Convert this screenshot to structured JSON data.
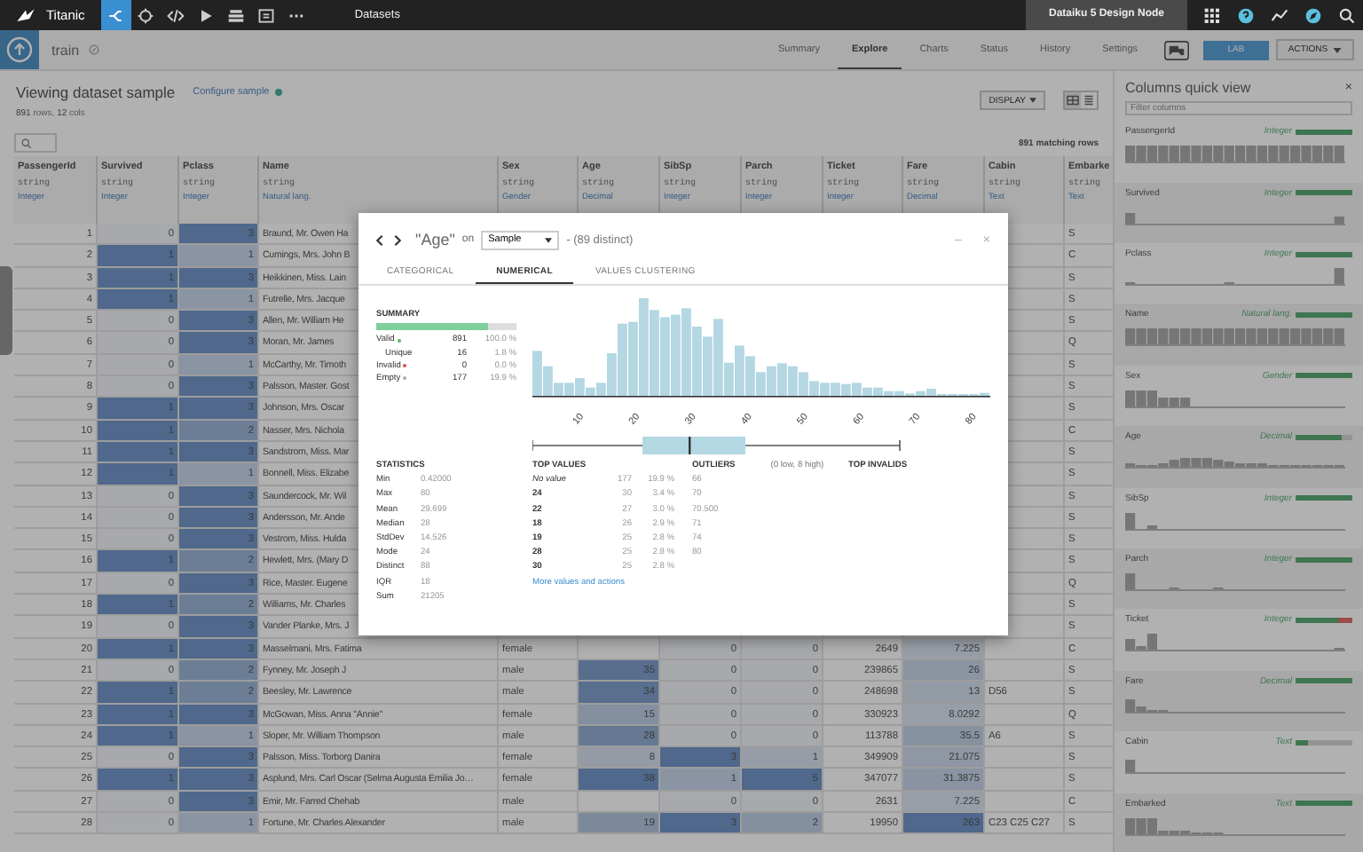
{
  "topbar": {
    "project": "Titanic",
    "nav": [
      {
        "kind": "flow",
        "selected": true
      },
      {
        "kind": "target",
        "selected": false
      },
      {
        "kind": "code",
        "selected": false
      },
      {
        "kind": "play",
        "selected": false
      },
      {
        "kind": "stack",
        "selected": false
      },
      {
        "kind": "dashboard",
        "selected": false
      },
      {
        "kind": "more",
        "selected": false
      }
    ],
    "section": "Datasets",
    "node": "Dataiku 5 Design Node",
    "tools": [
      {
        "kind": "apps"
      },
      {
        "kind": "help"
      },
      {
        "kind": "trend"
      },
      {
        "kind": "compass"
      },
      {
        "kind": "search"
      }
    ]
  },
  "dataset": {
    "name": "train",
    "tabs": [
      {
        "label": "Summary",
        "selected": false
      },
      {
        "label": "Explore",
        "selected": true
      },
      {
        "label": "Charts",
        "selected": false
      },
      {
        "label": "Status",
        "selected": false
      },
      {
        "label": "History",
        "selected": false
      },
      {
        "label": "Settings",
        "selected": false
      }
    ],
    "lab": "LAB",
    "actions": "ACTIONS"
  },
  "sample": {
    "title": "Viewing dataset sample",
    "configure": "Configure sample",
    "rows": "891",
    "rows_label": "rows,",
    "cols": "12",
    "cols_label": "cols",
    "display": "DISPLAY",
    "matching": "891 matching rows"
  },
  "table": {
    "columns": [
      {
        "name": "PassengerId",
        "storage": "string",
        "meaning": "Integer"
      },
      {
        "name": "Survived",
        "storage": "string",
        "meaning": "Integer"
      },
      {
        "name": "Pclass",
        "storage": "string",
        "meaning": "Integer"
      },
      {
        "name": "Name",
        "storage": "string",
        "meaning": "Natural lang."
      },
      {
        "name": "Sex",
        "storage": "string",
        "meaning": "Gender"
      },
      {
        "name": "Age",
        "storage": "string",
        "meaning": "Decimal"
      },
      {
        "name": "SibSp",
        "storage": "string",
        "meaning": "Integer"
      },
      {
        "name": "Parch",
        "storage": "string",
        "meaning": "Integer"
      },
      {
        "name": "Ticket",
        "storage": "string",
        "meaning": "Integer"
      },
      {
        "name": "Fare",
        "storage": "string",
        "meaning": "Decimal"
      },
      {
        "name": "Cabin",
        "storage": "string",
        "meaning": "Text"
      },
      {
        "name": "Embarke",
        "storage": "string",
        "meaning": "Text"
      }
    ],
    "rows": [
      [
        "1",
        "0",
        "3",
        "Braund, Mr. Owen Ha",
        null,
        null,
        null,
        null,
        null,
        null,
        null,
        "S"
      ],
      [
        "2",
        "1",
        "1",
        "Cumings, Mrs. John B",
        null,
        null,
        null,
        null,
        null,
        null,
        null,
        "C"
      ],
      [
        "3",
        "1",
        "3",
        "Heikkinen, Miss. Lain",
        null,
        null,
        null,
        null,
        null,
        null,
        null,
        "S"
      ],
      [
        "4",
        "1",
        "1",
        "Futrelle, Mrs. Jacque",
        null,
        null,
        null,
        null,
        null,
        null,
        null,
        "S"
      ],
      [
        "5",
        "0",
        "3",
        "Allen, Mr. William He",
        null,
        null,
        null,
        null,
        null,
        null,
        null,
        "S"
      ],
      [
        "6",
        "0",
        "3",
        "Moran, Mr. James",
        null,
        null,
        null,
        null,
        null,
        null,
        null,
        "Q"
      ],
      [
        "7",
        "0",
        "1",
        "McCarthy, Mr. Timoth",
        null,
        null,
        null,
        null,
        null,
        null,
        null,
        "S"
      ],
      [
        "8",
        "0",
        "3",
        "Palsson, Master. Gost",
        null,
        null,
        null,
        null,
        null,
        null,
        null,
        "S"
      ],
      [
        "9",
        "1",
        "3",
        "Johnson, Mrs. Oscar",
        null,
        null,
        null,
        null,
        null,
        null,
        null,
        "S"
      ],
      [
        "10",
        "1",
        "2",
        "Nasser, Mrs. Nichola",
        null,
        null,
        null,
        null,
        null,
        null,
        null,
        "C"
      ],
      [
        "11",
        "1",
        "3",
        "Sandstrom, Miss. Mar",
        null,
        null,
        null,
        null,
        null,
        null,
        null,
        "S"
      ],
      [
        "12",
        "1",
        "1",
        "Bonnell, Miss. Elizabe",
        null,
        null,
        null,
        null,
        null,
        null,
        null,
        "S"
      ],
      [
        "13",
        "0",
        "3",
        "Saundercock, Mr. Wil",
        null,
        null,
        null,
        null,
        null,
        null,
        null,
        "S"
      ],
      [
        "14",
        "0",
        "3",
        "Andersson, Mr. Ande",
        null,
        null,
        null,
        null,
        null,
        null,
        null,
        "S"
      ],
      [
        "15",
        "0",
        "3",
        "Vestrom, Miss. Hulda",
        null,
        null,
        null,
        null,
        null,
        null,
        null,
        "S"
      ],
      [
        "16",
        "1",
        "2",
        "Hewlett, Mrs. (Mary D",
        null,
        null,
        null,
        null,
        null,
        null,
        null,
        "S"
      ],
      [
        "17",
        "0",
        "3",
        "Rice, Master. Eugene",
        null,
        null,
        null,
        null,
        null,
        null,
        null,
        "Q"
      ],
      [
        "18",
        "1",
        "2",
        "Williams, Mr. Charles",
        null,
        null,
        null,
        null,
        null,
        null,
        null,
        "S"
      ],
      [
        "19",
        "0",
        "3",
        "Vander Planke, Mrs. J",
        null,
        null,
        null,
        null,
        null,
        null,
        null,
        "S"
      ],
      [
        "20",
        "1",
        "3",
        "Masselmani, Mrs. Fatima",
        "female",
        null,
        "0",
        "0",
        "2649",
        "7.225",
        null,
        "C"
      ],
      [
        "21",
        "0",
        "2",
        "Fynney, Mr. Joseph J",
        "male",
        "35",
        "0",
        "0",
        "239865",
        "26",
        null,
        "S"
      ],
      [
        "22",
        "1",
        "2",
        "Beesley, Mr. Lawrence",
        "male",
        "34",
        "0",
        "0",
        "248698",
        "13",
        "D56",
        "S"
      ],
      [
        "23",
        "1",
        "3",
        "McGowan, Miss. Anna \"Annie\"",
        "female",
        "15",
        "0",
        "0",
        "330923",
        "8.0292",
        null,
        "Q"
      ],
      [
        "24",
        "1",
        "1",
        "Sloper, Mr. William Thompson",
        "male",
        "28",
        "0",
        "0",
        "113788",
        "35.5",
        "A6",
        "S"
      ],
      [
        "25",
        "0",
        "3",
        "Palsson, Miss. Torborg Danira",
        "female",
        "8",
        "3",
        "1",
        "349909",
        "21.075",
        null,
        "S"
      ],
      [
        "26",
        "1",
        "3",
        "Asplund, Mrs. Carl Oscar (Selma Augusta Emilia Jo…",
        "female",
        "38",
        "1",
        "5",
        "347077",
        "31.3875",
        null,
        "S"
      ],
      [
        "27",
        "0",
        "3",
        "Emir, Mr. Farred Chehab",
        "male",
        null,
        "0",
        "0",
        "2631",
        "7.225",
        null,
        "C"
      ],
      [
        "28",
        "0",
        "1",
        "Fortune, Mr. Charles Alexander",
        "male",
        "19",
        "3",
        "2",
        "19950",
        "263",
        "C23 C25 C27",
        "S"
      ]
    ]
  },
  "quick_view": {
    "title": "Columns quick view",
    "close": "×",
    "placeholder": "Filter columns",
    "columns": [
      {
        "name": "PassengerId",
        "meaning": "Integer",
        "level": 1
      },
      {
        "name": "Survived",
        "meaning": "Integer",
        "level": 1
      },
      {
        "name": "Pclass",
        "meaning": "Integer",
        "level": 1
      },
      {
        "name": "Name",
        "meaning": "Natural lang.",
        "level": 1
      },
      {
        "name": "Sex",
        "meaning": "Gender",
        "level": 1
      },
      {
        "name": "Age",
        "meaning": "Decimal",
        "level": 0.8,
        "invalid": false
      },
      {
        "name": "SibSp",
        "meaning": "Integer",
        "level": 1
      },
      {
        "name": "Parch",
        "meaning": "Integer",
        "level": 1
      },
      {
        "name": "Ticket",
        "meaning": "Integer",
        "level": 0.74,
        "invalid": true
      },
      {
        "name": "Fare",
        "meaning": "Decimal",
        "level": 1
      },
      {
        "name": "Cabin",
        "meaning": "Text",
        "level": 0.23,
        "invalid": false
      },
      {
        "name": "Embarked",
        "meaning": "Text",
        "level": 1
      }
    ]
  },
  "dialog": {
    "column": "\"Age\"",
    "on": "on",
    "sample": "Sample",
    "distinct": "- (89 distinct)",
    "minimize": "–",
    "close": "×",
    "tabs": [
      {
        "label": "CATEGORICAL",
        "selected": false
      },
      {
        "label": "NUMERICAL",
        "selected": true
      },
      {
        "label": "VALUES CLUSTERING",
        "selected": false
      }
    ],
    "summary": {
      "title": "SUMMARY",
      "level": 0.8,
      "rows": [
        {
          "label": "Valid",
          "color": "#5cb85c",
          "count": "891",
          "pct": "100.0 %"
        },
        {
          "label": "Unique",
          "count": "16",
          "pct": "1.8 %"
        },
        {
          "label": "Invalid",
          "color": "#d9534f",
          "count": "0",
          "pct": "0.0 %"
        },
        {
          "label": "Empty",
          "color": "#aaaaaa",
          "count": "177",
          "pct": "19.9 %"
        }
      ]
    },
    "histogram": {
      "xticks": [
        "10",
        "20",
        "30",
        "40",
        "50",
        "60",
        "70",
        "80"
      ]
    },
    "statistics": {
      "title": "STATISTICS",
      "rows": [
        [
          "Min",
          "0.42000"
        ],
        [
          "Max",
          "80"
        ],
        [
          "Mean",
          "29.699"
        ],
        [
          "Median",
          "28"
        ],
        [
          "StdDev",
          "14.526"
        ],
        [
          "Mode",
          "24"
        ],
        [
          "Distinct",
          "88"
        ],
        [
          "IQR",
          "18"
        ],
        [
          "Sum",
          "21205"
        ]
      ]
    },
    "top_values": {
      "title": "TOP VALUES",
      "rows": [
        {
          "value": "No value",
          "missing": true,
          "count": "177",
          "pct": "19.9 %"
        },
        {
          "value": "24",
          "missing": false,
          "count": "30",
          "pct": "3.4 %"
        },
        {
          "value": "22",
          "missing": false,
          "count": "27",
          "pct": "3.0 %"
        },
        {
          "value": "18",
          "missing": false,
          "count": "26",
          "pct": "2.9 %"
        },
        {
          "value": "19",
          "missing": false,
          "count": "25",
          "pct": "2.8 %"
        },
        {
          "value": "28",
          "missing": false,
          "count": "25",
          "pct": "2.8 %"
        },
        {
          "value": "30",
          "missing": false,
          "count": "25",
          "pct": "2.8 %"
        }
      ],
      "more": "More values and actions"
    },
    "outliers": {
      "title": "OUTLIERS",
      "note": "(0 low, 8 high)",
      "values": [
        "66",
        "70",
        "70.500",
        "71",
        "74",
        "80"
      ]
    },
    "top_invalids": {
      "title": "TOP INVALIDS"
    }
  }
}
